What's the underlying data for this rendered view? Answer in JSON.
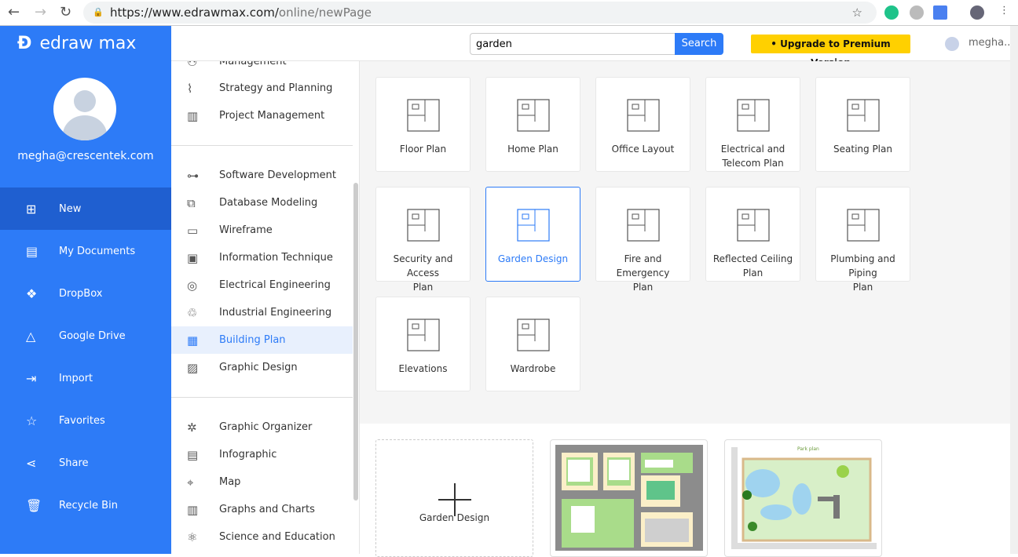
{
  "browser": {
    "url_host": "https://www.edrawmax.com/",
    "url_path": "online/newPage"
  },
  "app": {
    "name": "edraw max",
    "email": "megha@crescentek.com",
    "user_short": "megha..."
  },
  "search": {
    "value": "garden",
    "button": "Search"
  },
  "upgrade": "Upgrade to Premium Version",
  "sidebar": [
    {
      "label": "New",
      "icon": "plus-square-icon"
    },
    {
      "label": "My Documents",
      "icon": "document-icon"
    },
    {
      "label": "DropBox",
      "icon": "dropbox-icon"
    },
    {
      "label": "Google Drive",
      "icon": "drive-icon"
    },
    {
      "label": "Import",
      "icon": "import-icon"
    },
    {
      "label": "Favorites",
      "icon": "star-icon"
    },
    {
      "label": "Share",
      "icon": "share-icon"
    },
    {
      "label": "Recycle Bin",
      "icon": "trash-icon"
    }
  ],
  "categories": [
    {
      "label": "Management"
    },
    {
      "label": "Strategy and Planning"
    },
    {
      "label": "Project Management"
    },
    {
      "label": "Software Development"
    },
    {
      "label": "Database Modeling"
    },
    {
      "label": "Wireframe"
    },
    {
      "label": "Information Technique"
    },
    {
      "label": "Electrical Engineering"
    },
    {
      "label": "Industrial Engineering"
    },
    {
      "label": "Building Plan"
    },
    {
      "label": "Graphic Design"
    },
    {
      "label": "Graphic Organizer"
    },
    {
      "label": "Infographic"
    },
    {
      "label": "Map"
    },
    {
      "label": "Graphs and Charts"
    },
    {
      "label": "Science and Education"
    }
  ],
  "templates": [
    {
      "l1": "Floor Plan",
      "l2": ""
    },
    {
      "l1": "Home Plan",
      "l2": ""
    },
    {
      "l1": "Office Layout",
      "l2": ""
    },
    {
      "l1": "Electrical and",
      "l2": "Telecom Plan"
    },
    {
      "l1": "Seating Plan",
      "l2": ""
    },
    {
      "l1": "Security and Access",
      "l2": "Plan"
    },
    {
      "l1": "Garden Design",
      "l2": ""
    },
    {
      "l1": "Fire and Emergency",
      "l2": "Plan"
    },
    {
      "l1": "Reflected Ceiling",
      "l2": "Plan"
    },
    {
      "l1": "Plumbing and Piping",
      "l2": "Plan"
    },
    {
      "l1": "Elevations",
      "l2": ""
    },
    {
      "l1": "Wardrobe",
      "l2": ""
    }
  ],
  "examples": {
    "blank_label": "Garden Design",
    "park_title": "Park plan"
  }
}
